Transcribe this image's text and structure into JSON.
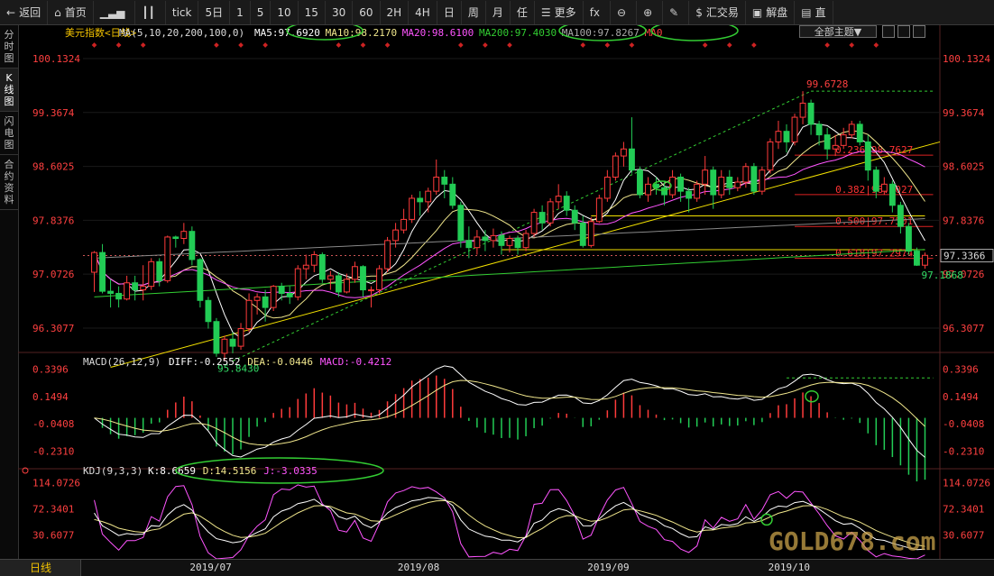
{
  "toolbar": [
    {
      "icon": "back-arrow-icon",
      "glyph": "←",
      "label": "返回"
    },
    {
      "icon": "home-icon",
      "glyph": "⌂",
      "label": "首页"
    },
    {
      "icon": "bar-chart-icon",
      "glyph": "▁▃▅",
      "label": ""
    },
    {
      "icon": "candles-icon",
      "glyph": "┃┃",
      "label": ""
    },
    {
      "icon": "",
      "glyph": "",
      "label": "tick"
    },
    {
      "icon": "",
      "glyph": "",
      "label": "5日"
    },
    {
      "icon": "",
      "glyph": "",
      "label": "1"
    },
    {
      "icon": "",
      "glyph": "",
      "label": "5"
    },
    {
      "icon": "",
      "glyph": "",
      "label": "10"
    },
    {
      "icon": "",
      "glyph": "",
      "label": "15"
    },
    {
      "icon": "",
      "glyph": "",
      "label": "30"
    },
    {
      "icon": "",
      "glyph": "",
      "label": "60"
    },
    {
      "icon": "",
      "glyph": "",
      "label": "2H"
    },
    {
      "icon": "",
      "glyph": "",
      "label": "4H"
    },
    {
      "icon": "",
      "glyph": "",
      "label": "日"
    },
    {
      "icon": "",
      "glyph": "",
      "label": "周"
    },
    {
      "icon": "",
      "glyph": "",
      "label": "月"
    },
    {
      "icon": "",
      "glyph": "",
      "label": "任"
    },
    {
      "icon": "list-icon",
      "glyph": "☰",
      "label": "更多"
    },
    {
      "icon": "fx-icon",
      "glyph": "fx",
      "label": ""
    },
    {
      "icon": "zoom-out-icon",
      "glyph": "⊖",
      "label": ""
    },
    {
      "icon": "zoom-in-icon",
      "glyph": "⊕",
      "label": ""
    },
    {
      "icon": "pen-icon",
      "glyph": "✎",
      "label": ""
    },
    {
      "icon": "dollar-icon",
      "glyph": "$",
      "label": "汇交易"
    },
    {
      "icon": "chat-icon",
      "glyph": "▣",
      "label": "解盘"
    },
    {
      "icon": "more-icon",
      "glyph": "▤",
      "label": "直"
    }
  ],
  "sidebar_tabs": [
    "分时图",
    "K线图",
    "闪电图",
    "合约资料"
  ],
  "sidebar_active": 1,
  "theme_button": "全部主题▼",
  "period_label": "日线",
  "chart_data": {
    "type": "candlestick",
    "instrument": "美元指数<日线>",
    "ma_header": {
      "label": "MA(5,10,20,200,100,0)",
      "items": [
        {
          "name": "MA5",
          "value": "97.6920",
          "color": "#ffffff"
        },
        {
          "name": "MA10",
          "value": "98.2170",
          "color": "#f0e68c"
        },
        {
          "name": "MA20",
          "value": "98.6100",
          "color": "#ff55ff"
        },
        {
          "name": "MA200",
          "value": "97.4030",
          "color": "#32cd32"
        },
        {
          "name": "MA100",
          "value": "97.8267",
          "color": "#aaaaaa"
        },
        {
          "name": "MA0",
          "value": "",
          "color": "#ff4040"
        }
      ]
    },
    "price_ticks": [
      "100.1324",
      "99.3674",
      "98.6025",
      "97.8376",
      "97.0726",
      "96.3077"
    ],
    "price_range": [
      96.0,
      100.35
    ],
    "high_label": "99.6728",
    "low_label": "95.8430",
    "last_low_label": "97.1868",
    "current_price": "97.3366",
    "fib_levels": [
      {
        "label": "0.236|98.7627",
        "value": 98.7627
      },
      {
        "label": "0.382|98.2027",
        "value": 98.2027
      },
      {
        "label": "0.500|97.7501",
        "value": 97.7501
      },
      {
        "label": "0.618|97.2974",
        "value": 97.2974
      }
    ],
    "x_labels": [
      "2019/07",
      "2019/08",
      "2019/09",
      "2019/10"
    ],
    "candles": [
      [
        97.1,
        97.38,
        96.82,
        97.4
      ],
      [
        97.38,
        96.83,
        96.8,
        97.5
      ],
      [
        96.83,
        96.8,
        96.6,
        97.0
      ],
      [
        96.8,
        96.72,
        96.6,
        96.9
      ],
      [
        96.72,
        96.95,
        96.7,
        97.05
      ],
      [
        96.95,
        96.85,
        96.7,
        97.05
      ],
      [
        96.85,
        96.9,
        96.7,
        97.2
      ],
      [
        96.9,
        97.25,
        96.85,
        97.3
      ],
      [
        97.25,
        96.98,
        96.9,
        97.3
      ],
      [
        96.98,
        97.6,
        96.95,
        97.62
      ],
      [
        97.6,
        97.58,
        97.45,
        97.62
      ],
      [
        97.58,
        97.68,
        97.5,
        97.8
      ],
      [
        97.68,
        97.28,
        97.2,
        97.75
      ],
      [
        97.28,
        96.7,
        96.6,
        97.3
      ],
      [
        96.7,
        96.4,
        96.3,
        96.75
      ],
      [
        96.4,
        95.95,
        95.9,
        96.45
      ],
      [
        95.95,
        96.15,
        95.84,
        96.2
      ],
      [
        96.15,
        96.05,
        95.95,
        96.25
      ],
      [
        96.05,
        96.3,
        96.0,
        96.38
      ],
      [
        96.3,
        96.7,
        96.25,
        96.8
      ],
      [
        96.7,
        96.75,
        96.5,
        96.8
      ],
      [
        96.75,
        96.6,
        96.4,
        96.85
      ],
      [
        96.6,
        96.9,
        96.55,
        96.92
      ],
      [
        96.9,
        96.8,
        96.7,
        96.95
      ],
      [
        96.8,
        96.75,
        96.65,
        96.9
      ],
      [
        96.75,
        97.15,
        96.7,
        97.2
      ],
      [
        97.15,
        97.2,
        97.0,
        97.35
      ],
      [
        97.2,
        97.35,
        97.1,
        97.4
      ],
      [
        97.35,
        97.0,
        96.95,
        97.38
      ],
      [
        97.0,
        97.05,
        96.85,
        97.12
      ],
      [
        97.05,
        96.82,
        96.75,
        97.1
      ],
      [
        96.82,
        97.0,
        96.8,
        97.08
      ],
      [
        97.0,
        97.18,
        96.95,
        97.25
      ],
      [
        97.18,
        96.85,
        96.75,
        97.2
      ],
      [
        96.85,
        96.85,
        96.6,
        96.9
      ],
      [
        96.85,
        97.15,
        96.8,
        97.2
      ],
      [
        97.15,
        97.55,
        97.1,
        97.6
      ],
      [
        97.55,
        97.7,
        97.45,
        97.8
      ],
      [
        97.7,
        97.85,
        97.65,
        98.0
      ],
      [
        97.85,
        98.15,
        97.8,
        98.2
      ],
      [
        98.15,
        98.1,
        97.9,
        98.25
      ],
      [
        98.1,
        98.25,
        97.95,
        98.3
      ],
      [
        98.25,
        98.45,
        98.2,
        98.7
      ],
      [
        98.45,
        98.35,
        98.15,
        98.55
      ],
      [
        98.35,
        98.05,
        98.0,
        98.45
      ],
      [
        98.05,
        97.55,
        97.45,
        98.1
      ],
      [
        97.55,
        97.45,
        97.3,
        97.75
      ],
      [
        97.45,
        97.6,
        97.35,
        97.7
      ],
      [
        97.6,
        97.55,
        97.4,
        97.7
      ],
      [
        97.55,
        97.62,
        97.45,
        97.72
      ],
      [
        97.62,
        97.48,
        97.35,
        97.68
      ],
      [
        97.48,
        97.58,
        97.38,
        97.62
      ],
      [
        97.58,
        97.45,
        97.35,
        97.62
      ],
      [
        97.45,
        97.65,
        97.4,
        97.7
      ],
      [
        97.65,
        97.95,
        97.6,
        98.0
      ],
      [
        97.95,
        97.8,
        97.7,
        98.05
      ],
      [
        97.8,
        98.1,
        97.75,
        98.15
      ],
      [
        98.1,
        98.18,
        98.0,
        98.35
      ],
      [
        98.18,
        97.98,
        97.9,
        98.25
      ],
      [
        97.98,
        97.8,
        97.7,
        98.05
      ],
      [
        97.8,
        97.48,
        97.45,
        97.9
      ],
      [
        97.48,
        97.82,
        97.45,
        97.88
      ],
      [
        97.82,
        98.15,
        97.8,
        98.2
      ],
      [
        98.15,
        98.45,
        98.1,
        98.55
      ],
      [
        98.45,
        98.75,
        98.4,
        98.8
      ],
      [
        98.75,
        98.85,
        98.6,
        98.95
      ],
      [
        98.85,
        98.55,
        98.5,
        99.3
      ],
      [
        98.55,
        98.2,
        98.15,
        98.6
      ],
      [
        98.2,
        98.35,
        98.1,
        98.45
      ],
      [
        98.35,
        98.3,
        98.2,
        98.45
      ],
      [
        98.3,
        98.2,
        98.05,
        98.4
      ],
      [
        98.2,
        98.45,
        98.15,
        98.55
      ],
      [
        98.45,
        98.25,
        98.1,
        98.5
      ],
      [
        98.25,
        98.15,
        97.95,
        98.3
      ],
      [
        98.15,
        98.35,
        98.1,
        98.4
      ],
      [
        98.35,
        98.55,
        98.2,
        98.75
      ],
      [
        98.55,
        98.2,
        98.0,
        98.6
      ],
      [
        98.2,
        98.45,
        98.15,
        98.55
      ],
      [
        98.45,
        98.3,
        98.2,
        98.55
      ],
      [
        98.3,
        98.38,
        98.25,
        98.45
      ],
      [
        98.38,
        98.6,
        98.3,
        98.65
      ],
      [
        98.6,
        98.25,
        98.2,
        98.65
      ],
      [
        98.25,
        98.55,
        98.2,
        98.6
      ],
      [
        98.55,
        98.95,
        98.5,
        99.0
      ],
      [
        98.95,
        99.1,
        98.85,
        99.25
      ],
      [
        99.1,
        98.95,
        98.8,
        99.2
      ],
      [
        98.95,
        99.3,
        98.9,
        99.35
      ],
      [
        99.3,
        99.5,
        99.2,
        99.67
      ],
      [
        99.5,
        99.2,
        99.05,
        99.55
      ],
      [
        99.2,
        99.05,
        98.9,
        99.25
      ],
      [
        99.05,
        98.85,
        98.7,
        99.15
      ],
      [
        98.85,
        98.9,
        98.75,
        99.05
      ],
      [
        98.9,
        99.05,
        98.85,
        99.15
      ],
      [
        99.05,
        99.2,
        99.0,
        99.25
      ],
      [
        99.2,
        98.95,
        98.9,
        99.25
      ],
      [
        98.95,
        98.55,
        98.4,
        99.05
      ],
      [
        98.55,
        98.25,
        98.15,
        98.6
      ],
      [
        98.25,
        98.35,
        98.2,
        98.45
      ],
      [
        98.35,
        98.05,
        97.95,
        98.4
      ],
      [
        98.05,
        97.75,
        97.65,
        98.1
      ],
      [
        97.75,
        97.4,
        97.35,
        97.8
      ],
      [
        97.4,
        97.2,
        97.19,
        97.45
      ],
      [
        97.2,
        97.34,
        97.15,
        97.38
      ]
    ],
    "macd": {
      "label": "MACD(26,12,9)",
      "values": [
        {
          "name": "DIFF",
          "value": "-0.2552",
          "color": "#ffffff"
        },
        {
          "name": "DEA",
          "value": "-0.0446",
          "color": "#f0e68c"
        },
        {
          "name": "MACD",
          "value": "-0.4212",
          "color": "#ff55ff"
        }
      ],
      "ticks": [
        "0.3396",
        "0.1494",
        "-0.0408",
        "-0.2310"
      ],
      "range": [
        -0.33,
        0.4
      ]
    },
    "kdj": {
      "label": "KDJ(9,3,3)",
      "values": [
        {
          "name": "K",
          "value": "8.6659",
          "color": "#ffffff"
        },
        {
          "name": "D",
          "value": "14.5156",
          "color": "#f0e68c"
        },
        {
          "name": "J",
          "value": "-3.0335",
          "color": "#ff55ff"
        }
      ],
      "ticks": [
        "114.0726",
        "72.3401",
        "30.6077"
      ],
      "range": [
        -8,
        125
      ]
    }
  },
  "watermark": "GOLD678.com"
}
